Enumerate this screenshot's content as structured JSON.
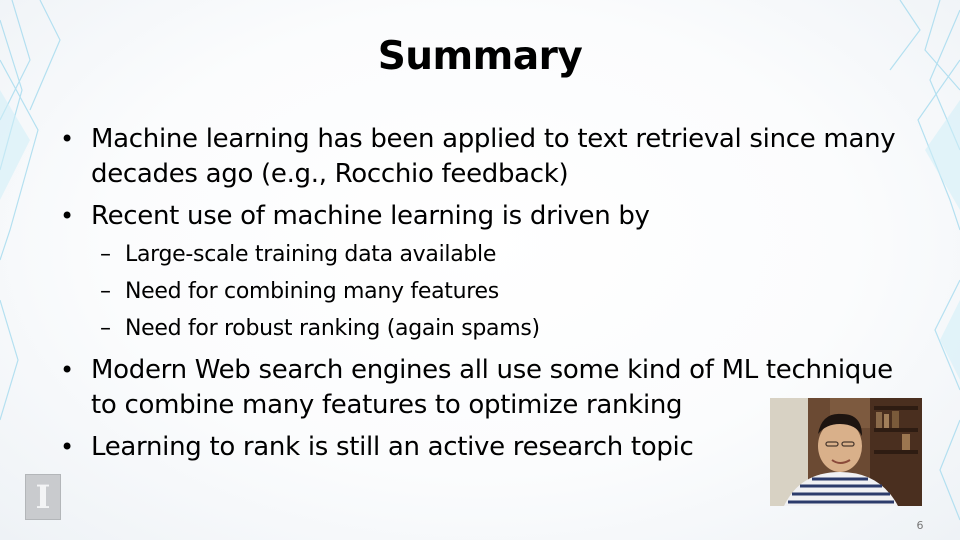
{
  "slide": {
    "title": "Summary",
    "bullets": [
      {
        "text": "Machine learning has been applied to text retrieval since many decades ago (e.g., Rocchio feedback)",
        "lines": [
          "Machine learning has been applied to text retrieval since many",
          "decades ago (e.g., Rocchio feedback)"
        ],
        "sub": []
      },
      {
        "text": "Recent use of machine learning is driven by",
        "lines": [
          "Recent use of machine learning is driven by"
        ],
        "sub": [
          "Large-scale training data available",
          "Need for combining many features",
          "Need for robust ranking (again spams)"
        ]
      },
      {
        "text": "Modern Web search engines all use some kind of ML technique to combine many features to optimize ranking",
        "lines": [
          "Modern Web search engines all use some kind of ML technique",
          "to combine many features to optimize ranking"
        ],
        "sub": []
      },
      {
        "text": "Learning to rank is still an active research topic",
        "lines": [
          "Learning to rank is still an active research topic"
        ],
        "sub": []
      }
    ],
    "bullet_glyph": "•",
    "sub_glyph": "–",
    "page_number": "6",
    "logo_icon": "university-block-i-logo",
    "logo_glyph": "I",
    "video_overlay": "presenter-webcam-thumbnail"
  },
  "colors": {
    "text": "#000000",
    "accent_lines": "#8fd3ea",
    "background": "#ffffff"
  }
}
